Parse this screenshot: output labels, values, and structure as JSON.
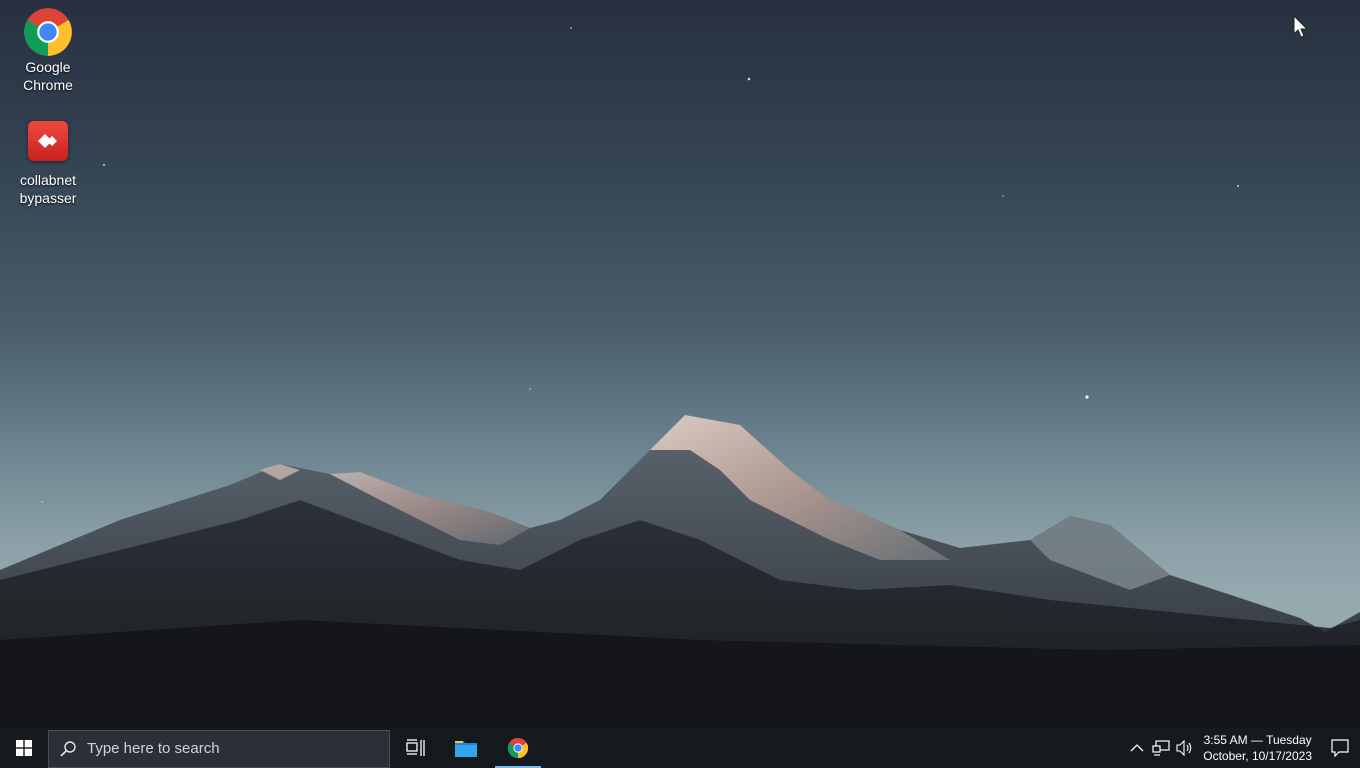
{
  "desktop": {
    "icons": [
      {
        "label_line1": "Google",
        "label_line2": "Chrome",
        "icon": "chrome-icon"
      },
      {
        "label_line1": "collabnet",
        "label_line2": "bypasser",
        "icon": "anydesk-icon"
      }
    ]
  },
  "taskbar": {
    "start_icon": "windows-logo-icon",
    "search": {
      "placeholder": "Type here to search",
      "icon": "search-icon"
    },
    "pinned": [
      {
        "name": "Task View",
        "icon": "task-view-icon"
      },
      {
        "name": "File Explorer",
        "icon": "folder-icon"
      },
      {
        "name": "Google Chrome",
        "icon": "chrome-icon",
        "active": true
      }
    ],
    "tray": {
      "icons": [
        "chevron-up-icon",
        "network-icon",
        "volume-icon"
      ],
      "time": "3:55 AM — Tuesday",
      "date": "October, 10/17/2023",
      "notification_icon": "action-center-icon"
    }
  },
  "colors": {
    "taskbar": "#151a1f",
    "accent_underline": "#76b9ed",
    "collab_red": "#e0302a"
  }
}
